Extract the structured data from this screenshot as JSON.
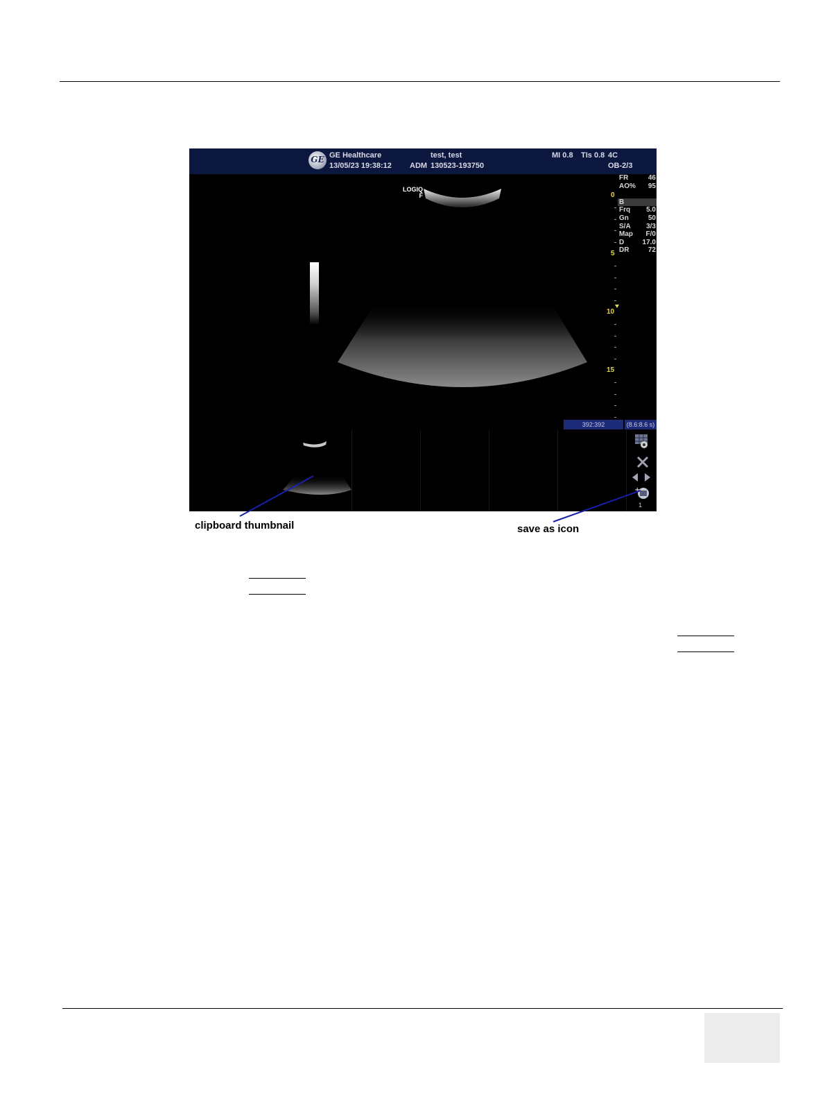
{
  "screen": {
    "header": {
      "brand": "GE Healthcare",
      "datetime": "13/05/23 19:38:12",
      "patient_name": "test, test",
      "operator": "ADM",
      "exam_id": "130523-193750",
      "mi": "MI 0.8",
      "tis": "TIs 0.8",
      "probe": "4C",
      "preset": "OB-2/3"
    },
    "logo_text": [
      "LOGIQ",
      "F"
    ],
    "params": [
      {
        "key": "FR",
        "value": "46"
      },
      {
        "key": "AO%",
        "value": "95"
      },
      {
        "key": "B",
        "value": ""
      },
      {
        "key": "Frq",
        "value": "5.0"
      },
      {
        "key": "Gn",
        "value": "50"
      },
      {
        "key": "S/A",
        "value": "3/3"
      },
      {
        "key": "Map",
        "value": "F/0"
      },
      {
        "key": "D",
        "value": "17.0"
      },
      {
        "key": "DR",
        "value": "72"
      }
    ],
    "depth_marks": [
      "0",
      "5",
      "10",
      "15"
    ],
    "cine_frames": "392:392",
    "cine_time": "(8.6:8.6 s)",
    "clip_count": "1",
    "icons": [
      "grid-capture-icon",
      "delete-icon",
      "page-arrows-icon",
      "save-as-icon"
    ]
  },
  "captions": {
    "clipboard": "clipboard thumbnail",
    "save_as": "save as icon"
  },
  "colors": {
    "header_bg": "#0c1740",
    "depth_text": "#e6d84a",
    "status_bg": "#1d2b78",
    "pointer": "#1a1fa8"
  }
}
